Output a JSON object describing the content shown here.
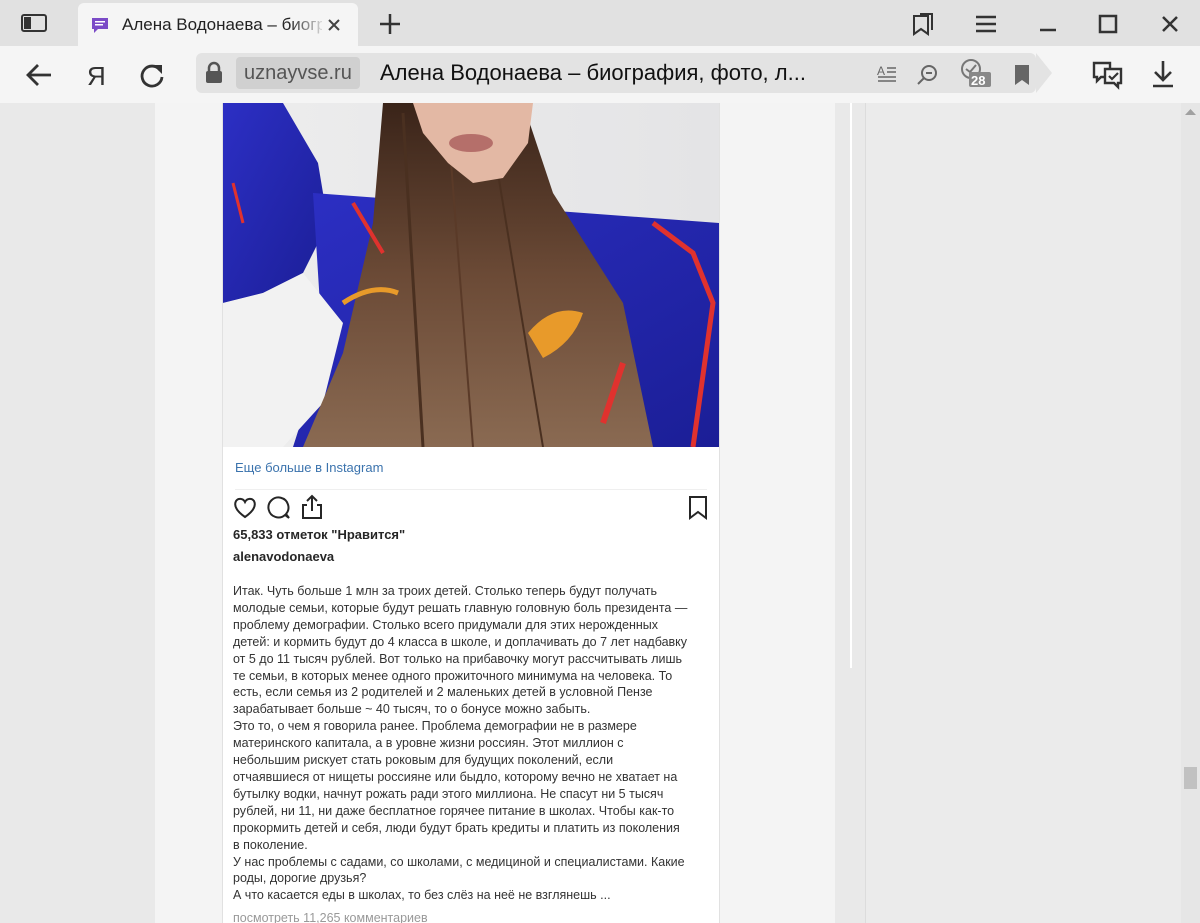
{
  "browser": {
    "tab_title": "Алена Водонаева – биография, фото, личная жизнь",
    "address_domain": "uznayvse.ru",
    "address_title": "Алена Водонаева – биография, фото, л...",
    "notification_count": "28",
    "icons": [
      "sidebar-icon",
      "tab-favicon",
      "close-icon",
      "plus-icon",
      "collections-icon",
      "menu-icon",
      "minimize-icon",
      "maximize-icon",
      "window-close-icon",
      "back-icon",
      "yandex-icon",
      "reload-icon",
      "lock-icon",
      "reader-icon",
      "zoom-icon",
      "notifications-icon",
      "bookmark-icon",
      "protect-icon",
      "download-icon"
    ]
  },
  "post": {
    "more_link": "Еще больше в Instagram",
    "likes": "65,833 отметок \"Нравится\"",
    "username": "alenavodonaeva",
    "caption": "Итак. Чуть больше 1 млн за троих детей. Столько теперь будут получать\nмолодые семьи, которые будут решать главную головную боль президента —\nпроблему демографии. Столько всего придумали для этих нерожденных\nдетей: и кормить будут до 4 класса в школе, и доплачивать до 7 лет надбавку\nот 5 до 11 тысяч рублей. Вот только на прибавочку могут рассчитывать лишь\nте семьи, в которых менее одного прожиточного минимума на человека. То\nесть, если семья из 2 родителей и 2 маленьких детей в условной Пензе\nзарабатывает больше ~ 40 тысяч, то о бонусе можно забыть.\nЭто то, о чем я говорила ранее. Проблема демографии не в размере\nматеринского капитала, а в уровне жизни россиян. Этот миллион с\nнебольшим рискует стать роковым для будущих поколений, если\nотчаявшиеся от нищеты россияне или быдло, которому вечно не хватает на\nбутылку водки, начнут рожать ради этого миллиона. Не спасут ни 5 тысяч\nрублей, ни 11, ни даже бесплатное горячее питание в школах. Чтобы как-то\nпрокормить детей и себя, люди будут брать кредиты и платить из поколения\nв поколение.\nУ нас проблемы с садами, со школами, с медициной и специалистами. Какие\nроды, дорогие друзья?\nА что касается еды в школах, то без слёз на неё не взглянешь ...",
    "comments": "посмотреть 11,265 комментариев"
  }
}
